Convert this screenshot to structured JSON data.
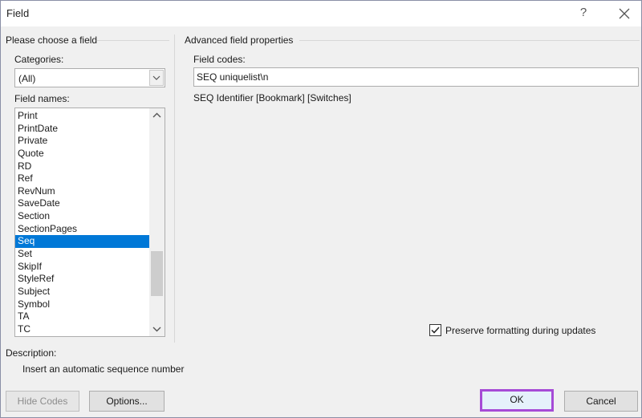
{
  "window": {
    "title": "Field",
    "help_glyph": "?"
  },
  "left_panel": {
    "heading": "Please choose a field",
    "categories_label": "Categories:",
    "categories_value": "(All)",
    "field_names_label": "Field names:",
    "field_names": [
      "Print",
      "PrintDate",
      "Private",
      "Quote",
      "RD",
      "Ref",
      "RevNum",
      "SaveDate",
      "Section",
      "SectionPages",
      "Seq",
      "Set",
      "SkipIf",
      "StyleRef",
      "Subject",
      "Symbol",
      "TA",
      "TC"
    ],
    "selected_field": "Seq"
  },
  "right_panel": {
    "heading": "Advanced field properties",
    "field_codes_label": "Field codes:",
    "field_codes_value": "SEQ uniquelist\\n",
    "syntax_hint": "SEQ Identifier [Bookmark] [Switches]",
    "preserve_label": "Preserve formatting during updates",
    "preserve_checked": true
  },
  "description": {
    "label": "Description:",
    "text": "Insert an automatic sequence number"
  },
  "buttons": {
    "hide_codes": "Hide Codes",
    "options": "Options...",
    "ok": "OK",
    "cancel": "Cancel"
  },
  "colors": {
    "selection": "#0078d7",
    "ok_highlight": "#a64bd6"
  },
  "icons": [
    "close-icon",
    "chevron-down-icon",
    "chevron-up-icon",
    "checkmark-icon"
  ]
}
